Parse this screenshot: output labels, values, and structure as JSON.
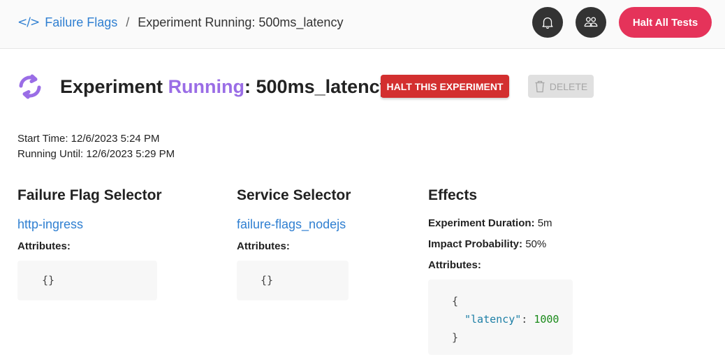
{
  "breadcrumb": {
    "icon": "code-icon",
    "root": "Failure Flags",
    "separator": "/",
    "current": "Experiment Running: 500ms_latency"
  },
  "header": {
    "notifications_icon": "bell-icon",
    "users_icon": "users-icon",
    "halt_all_label": "Halt All Tests"
  },
  "experiment": {
    "status_icon": "sync-icon",
    "title_prefix": "Experiment ",
    "status": "Running",
    "title_suffix": ": 500ms_latency",
    "halt_label": "HALT THIS EXPERIMENT",
    "delete_label": "DELETE",
    "start_time": "Start Time: 12/6/2023 5:24 PM",
    "running_until": "Running Until: 12/6/2023 5:29 PM"
  },
  "failure_flag_selector": {
    "heading": "Failure Flag Selector",
    "name": "http-ingress",
    "attributes_label": "Attributes:",
    "attributes": "{}"
  },
  "service_selector": {
    "heading": "Service Selector",
    "name": "failure-flags_nodejs",
    "attributes_label": "Attributes:",
    "attributes": "{}"
  },
  "effects": {
    "heading": "Effects",
    "duration_label": "Experiment Duration:",
    "duration": "5m",
    "probability_label": "Impact Probability:",
    "probability": "50%",
    "attributes_label": "Attributes:",
    "open_brace": "{",
    "key": "\"latency\"",
    "colon": ": ",
    "value": "1000",
    "close_brace": "}"
  }
}
